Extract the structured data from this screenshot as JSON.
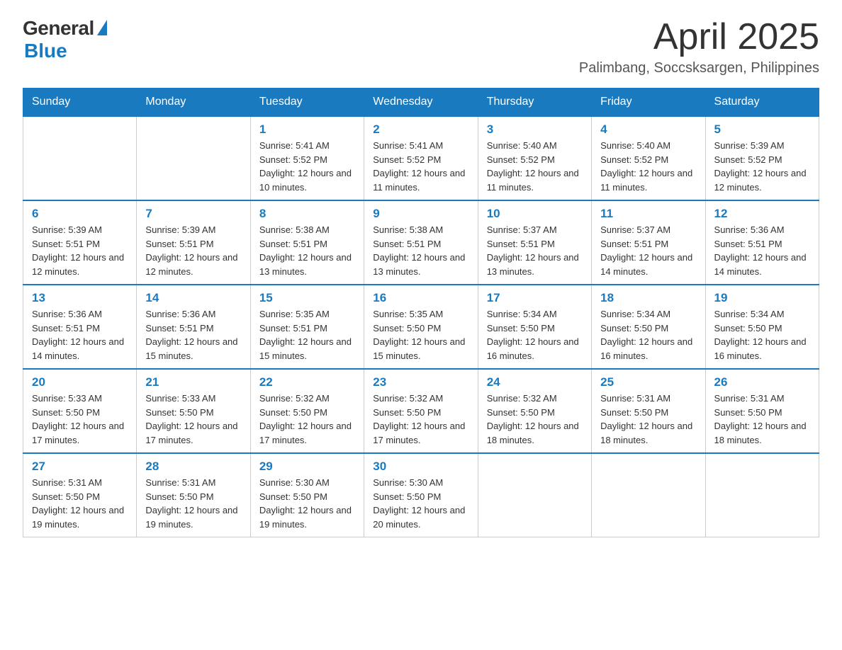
{
  "logo": {
    "general": "General",
    "blue": "Blue"
  },
  "title": "April 2025",
  "location": "Palimbang, Soccsksargen, Philippines",
  "days_of_week": [
    "Sunday",
    "Monday",
    "Tuesday",
    "Wednesday",
    "Thursday",
    "Friday",
    "Saturday"
  ],
  "weeks": [
    [
      {
        "day": "",
        "sunrise": "",
        "sunset": "",
        "daylight": ""
      },
      {
        "day": "",
        "sunrise": "",
        "sunset": "",
        "daylight": ""
      },
      {
        "day": "1",
        "sunrise": "Sunrise: 5:41 AM",
        "sunset": "Sunset: 5:52 PM",
        "daylight": "Daylight: 12 hours and 10 minutes."
      },
      {
        "day": "2",
        "sunrise": "Sunrise: 5:41 AM",
        "sunset": "Sunset: 5:52 PM",
        "daylight": "Daylight: 12 hours and 11 minutes."
      },
      {
        "day": "3",
        "sunrise": "Sunrise: 5:40 AM",
        "sunset": "Sunset: 5:52 PM",
        "daylight": "Daylight: 12 hours and 11 minutes."
      },
      {
        "day": "4",
        "sunrise": "Sunrise: 5:40 AM",
        "sunset": "Sunset: 5:52 PM",
        "daylight": "Daylight: 12 hours and 11 minutes."
      },
      {
        "day": "5",
        "sunrise": "Sunrise: 5:39 AM",
        "sunset": "Sunset: 5:52 PM",
        "daylight": "Daylight: 12 hours and 12 minutes."
      }
    ],
    [
      {
        "day": "6",
        "sunrise": "Sunrise: 5:39 AM",
        "sunset": "Sunset: 5:51 PM",
        "daylight": "Daylight: 12 hours and 12 minutes."
      },
      {
        "day": "7",
        "sunrise": "Sunrise: 5:39 AM",
        "sunset": "Sunset: 5:51 PM",
        "daylight": "Daylight: 12 hours and 12 minutes."
      },
      {
        "day": "8",
        "sunrise": "Sunrise: 5:38 AM",
        "sunset": "Sunset: 5:51 PM",
        "daylight": "Daylight: 12 hours and 13 minutes."
      },
      {
        "day": "9",
        "sunrise": "Sunrise: 5:38 AM",
        "sunset": "Sunset: 5:51 PM",
        "daylight": "Daylight: 12 hours and 13 minutes."
      },
      {
        "day": "10",
        "sunrise": "Sunrise: 5:37 AM",
        "sunset": "Sunset: 5:51 PM",
        "daylight": "Daylight: 12 hours and 13 minutes."
      },
      {
        "day": "11",
        "sunrise": "Sunrise: 5:37 AM",
        "sunset": "Sunset: 5:51 PM",
        "daylight": "Daylight: 12 hours and 14 minutes."
      },
      {
        "day": "12",
        "sunrise": "Sunrise: 5:36 AM",
        "sunset": "Sunset: 5:51 PM",
        "daylight": "Daylight: 12 hours and 14 minutes."
      }
    ],
    [
      {
        "day": "13",
        "sunrise": "Sunrise: 5:36 AM",
        "sunset": "Sunset: 5:51 PM",
        "daylight": "Daylight: 12 hours and 14 minutes."
      },
      {
        "day": "14",
        "sunrise": "Sunrise: 5:36 AM",
        "sunset": "Sunset: 5:51 PM",
        "daylight": "Daylight: 12 hours and 15 minutes."
      },
      {
        "day": "15",
        "sunrise": "Sunrise: 5:35 AM",
        "sunset": "Sunset: 5:51 PM",
        "daylight": "Daylight: 12 hours and 15 minutes."
      },
      {
        "day": "16",
        "sunrise": "Sunrise: 5:35 AM",
        "sunset": "Sunset: 5:50 PM",
        "daylight": "Daylight: 12 hours and 15 minutes."
      },
      {
        "day": "17",
        "sunrise": "Sunrise: 5:34 AM",
        "sunset": "Sunset: 5:50 PM",
        "daylight": "Daylight: 12 hours and 16 minutes."
      },
      {
        "day": "18",
        "sunrise": "Sunrise: 5:34 AM",
        "sunset": "Sunset: 5:50 PM",
        "daylight": "Daylight: 12 hours and 16 minutes."
      },
      {
        "day": "19",
        "sunrise": "Sunrise: 5:34 AM",
        "sunset": "Sunset: 5:50 PM",
        "daylight": "Daylight: 12 hours and 16 minutes."
      }
    ],
    [
      {
        "day": "20",
        "sunrise": "Sunrise: 5:33 AM",
        "sunset": "Sunset: 5:50 PM",
        "daylight": "Daylight: 12 hours and 17 minutes."
      },
      {
        "day": "21",
        "sunrise": "Sunrise: 5:33 AM",
        "sunset": "Sunset: 5:50 PM",
        "daylight": "Daylight: 12 hours and 17 minutes."
      },
      {
        "day": "22",
        "sunrise": "Sunrise: 5:32 AM",
        "sunset": "Sunset: 5:50 PM",
        "daylight": "Daylight: 12 hours and 17 minutes."
      },
      {
        "day": "23",
        "sunrise": "Sunrise: 5:32 AM",
        "sunset": "Sunset: 5:50 PM",
        "daylight": "Daylight: 12 hours and 17 minutes."
      },
      {
        "day": "24",
        "sunrise": "Sunrise: 5:32 AM",
        "sunset": "Sunset: 5:50 PM",
        "daylight": "Daylight: 12 hours and 18 minutes."
      },
      {
        "day": "25",
        "sunrise": "Sunrise: 5:31 AM",
        "sunset": "Sunset: 5:50 PM",
        "daylight": "Daylight: 12 hours and 18 minutes."
      },
      {
        "day": "26",
        "sunrise": "Sunrise: 5:31 AM",
        "sunset": "Sunset: 5:50 PM",
        "daylight": "Daylight: 12 hours and 18 minutes."
      }
    ],
    [
      {
        "day": "27",
        "sunrise": "Sunrise: 5:31 AM",
        "sunset": "Sunset: 5:50 PM",
        "daylight": "Daylight: 12 hours and 19 minutes."
      },
      {
        "day": "28",
        "sunrise": "Sunrise: 5:31 AM",
        "sunset": "Sunset: 5:50 PM",
        "daylight": "Daylight: 12 hours and 19 minutes."
      },
      {
        "day": "29",
        "sunrise": "Sunrise: 5:30 AM",
        "sunset": "Sunset: 5:50 PM",
        "daylight": "Daylight: 12 hours and 19 minutes."
      },
      {
        "day": "30",
        "sunrise": "Sunrise: 5:30 AM",
        "sunset": "Sunset: 5:50 PM",
        "daylight": "Daylight: 12 hours and 20 minutes."
      },
      {
        "day": "",
        "sunrise": "",
        "sunset": "",
        "daylight": ""
      },
      {
        "day": "",
        "sunrise": "",
        "sunset": "",
        "daylight": ""
      },
      {
        "day": "",
        "sunrise": "",
        "sunset": "",
        "daylight": ""
      }
    ]
  ]
}
